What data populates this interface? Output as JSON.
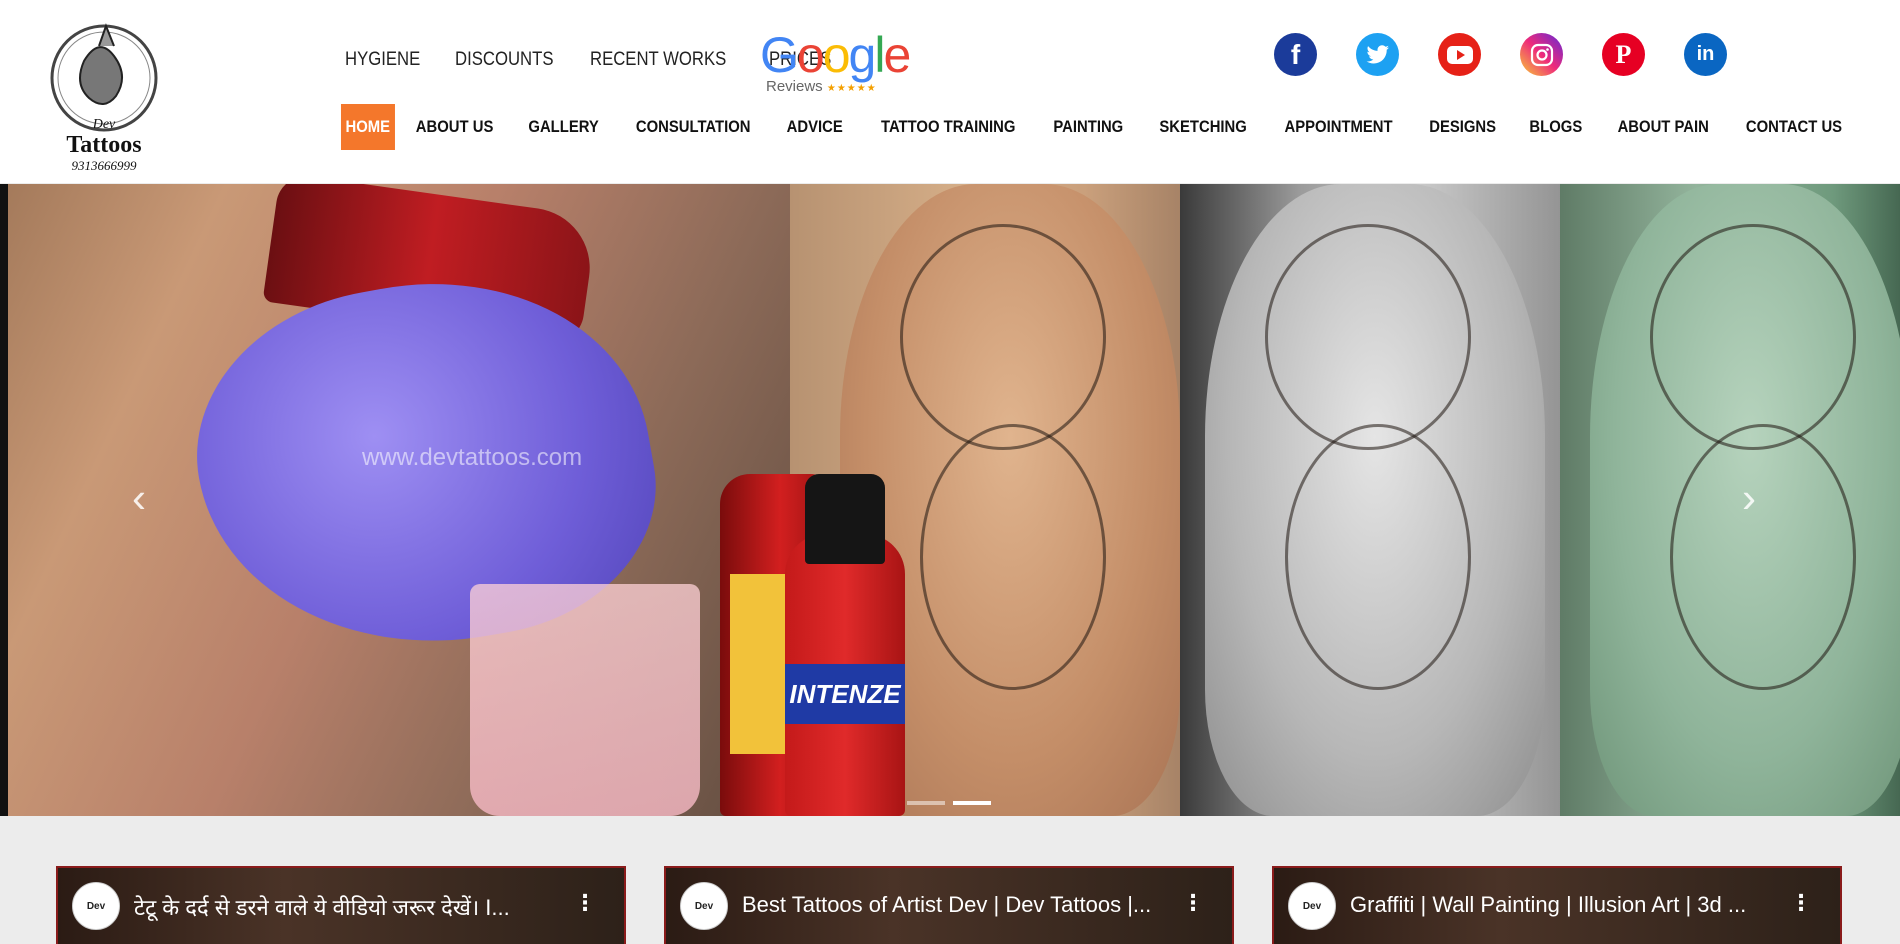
{
  "logo": {
    "name": "Dev",
    "brand": "Tattoos",
    "phone": "9313666999"
  },
  "top_links": [
    "HYGIENE",
    "DISCOUNTS",
    "RECENT WORKS",
    "PRICES"
  ],
  "google_reviews": {
    "word": "Google",
    "sub": "Reviews",
    "stars": "★★★★★"
  },
  "social": [
    {
      "icon": "facebook-icon",
      "glyph": "f",
      "color": "#1b3b9a"
    },
    {
      "icon": "twitter-icon",
      "glyph": "t",
      "color": "#1da1f2"
    },
    {
      "icon": "youtube-icon",
      "glyph": "▶",
      "color": "#e62117"
    },
    {
      "icon": "instagram-icon",
      "glyph": "◎",
      "color": "#c13584"
    },
    {
      "icon": "pinterest-icon",
      "glyph": "P",
      "color": "#e60023"
    },
    {
      "icon": "linkedin-icon",
      "glyph": "in",
      "color": "#0a66c2"
    }
  ],
  "nav": {
    "active": "HOME",
    "items": [
      "HOME",
      "ABOUT US",
      "GALLERY",
      "CONSULTATION",
      "ADVICE",
      "TATTOO TRAINING",
      "PAINTING",
      "SKETCHING",
      "APPOINTMENT",
      "DESIGNS",
      "BLOGS",
      "ABOUT PAIN",
      "CONTACT US"
    ]
  },
  "slider": {
    "watermark": "www.devtattoos.com",
    "bottle_label": "INTENZE",
    "prev": "‹",
    "next": "›",
    "slides": 2,
    "active_slide": 2
  },
  "videos": [
    {
      "title": "टेटू के दर्द से डरने वाले ये वीडियो जरूर देखें। I...",
      "menu": "⋮"
    },
    {
      "title": "Best Tattoos of Artist Dev | Dev Tattoos |...",
      "menu": "⋮"
    },
    {
      "title": "Graffiti | Wall Painting | Illusion Art | 3d ...",
      "menu": "⋮"
    }
  ],
  "colors": {
    "accent": "#f4772b",
    "video_border": "#8a1b1b"
  }
}
